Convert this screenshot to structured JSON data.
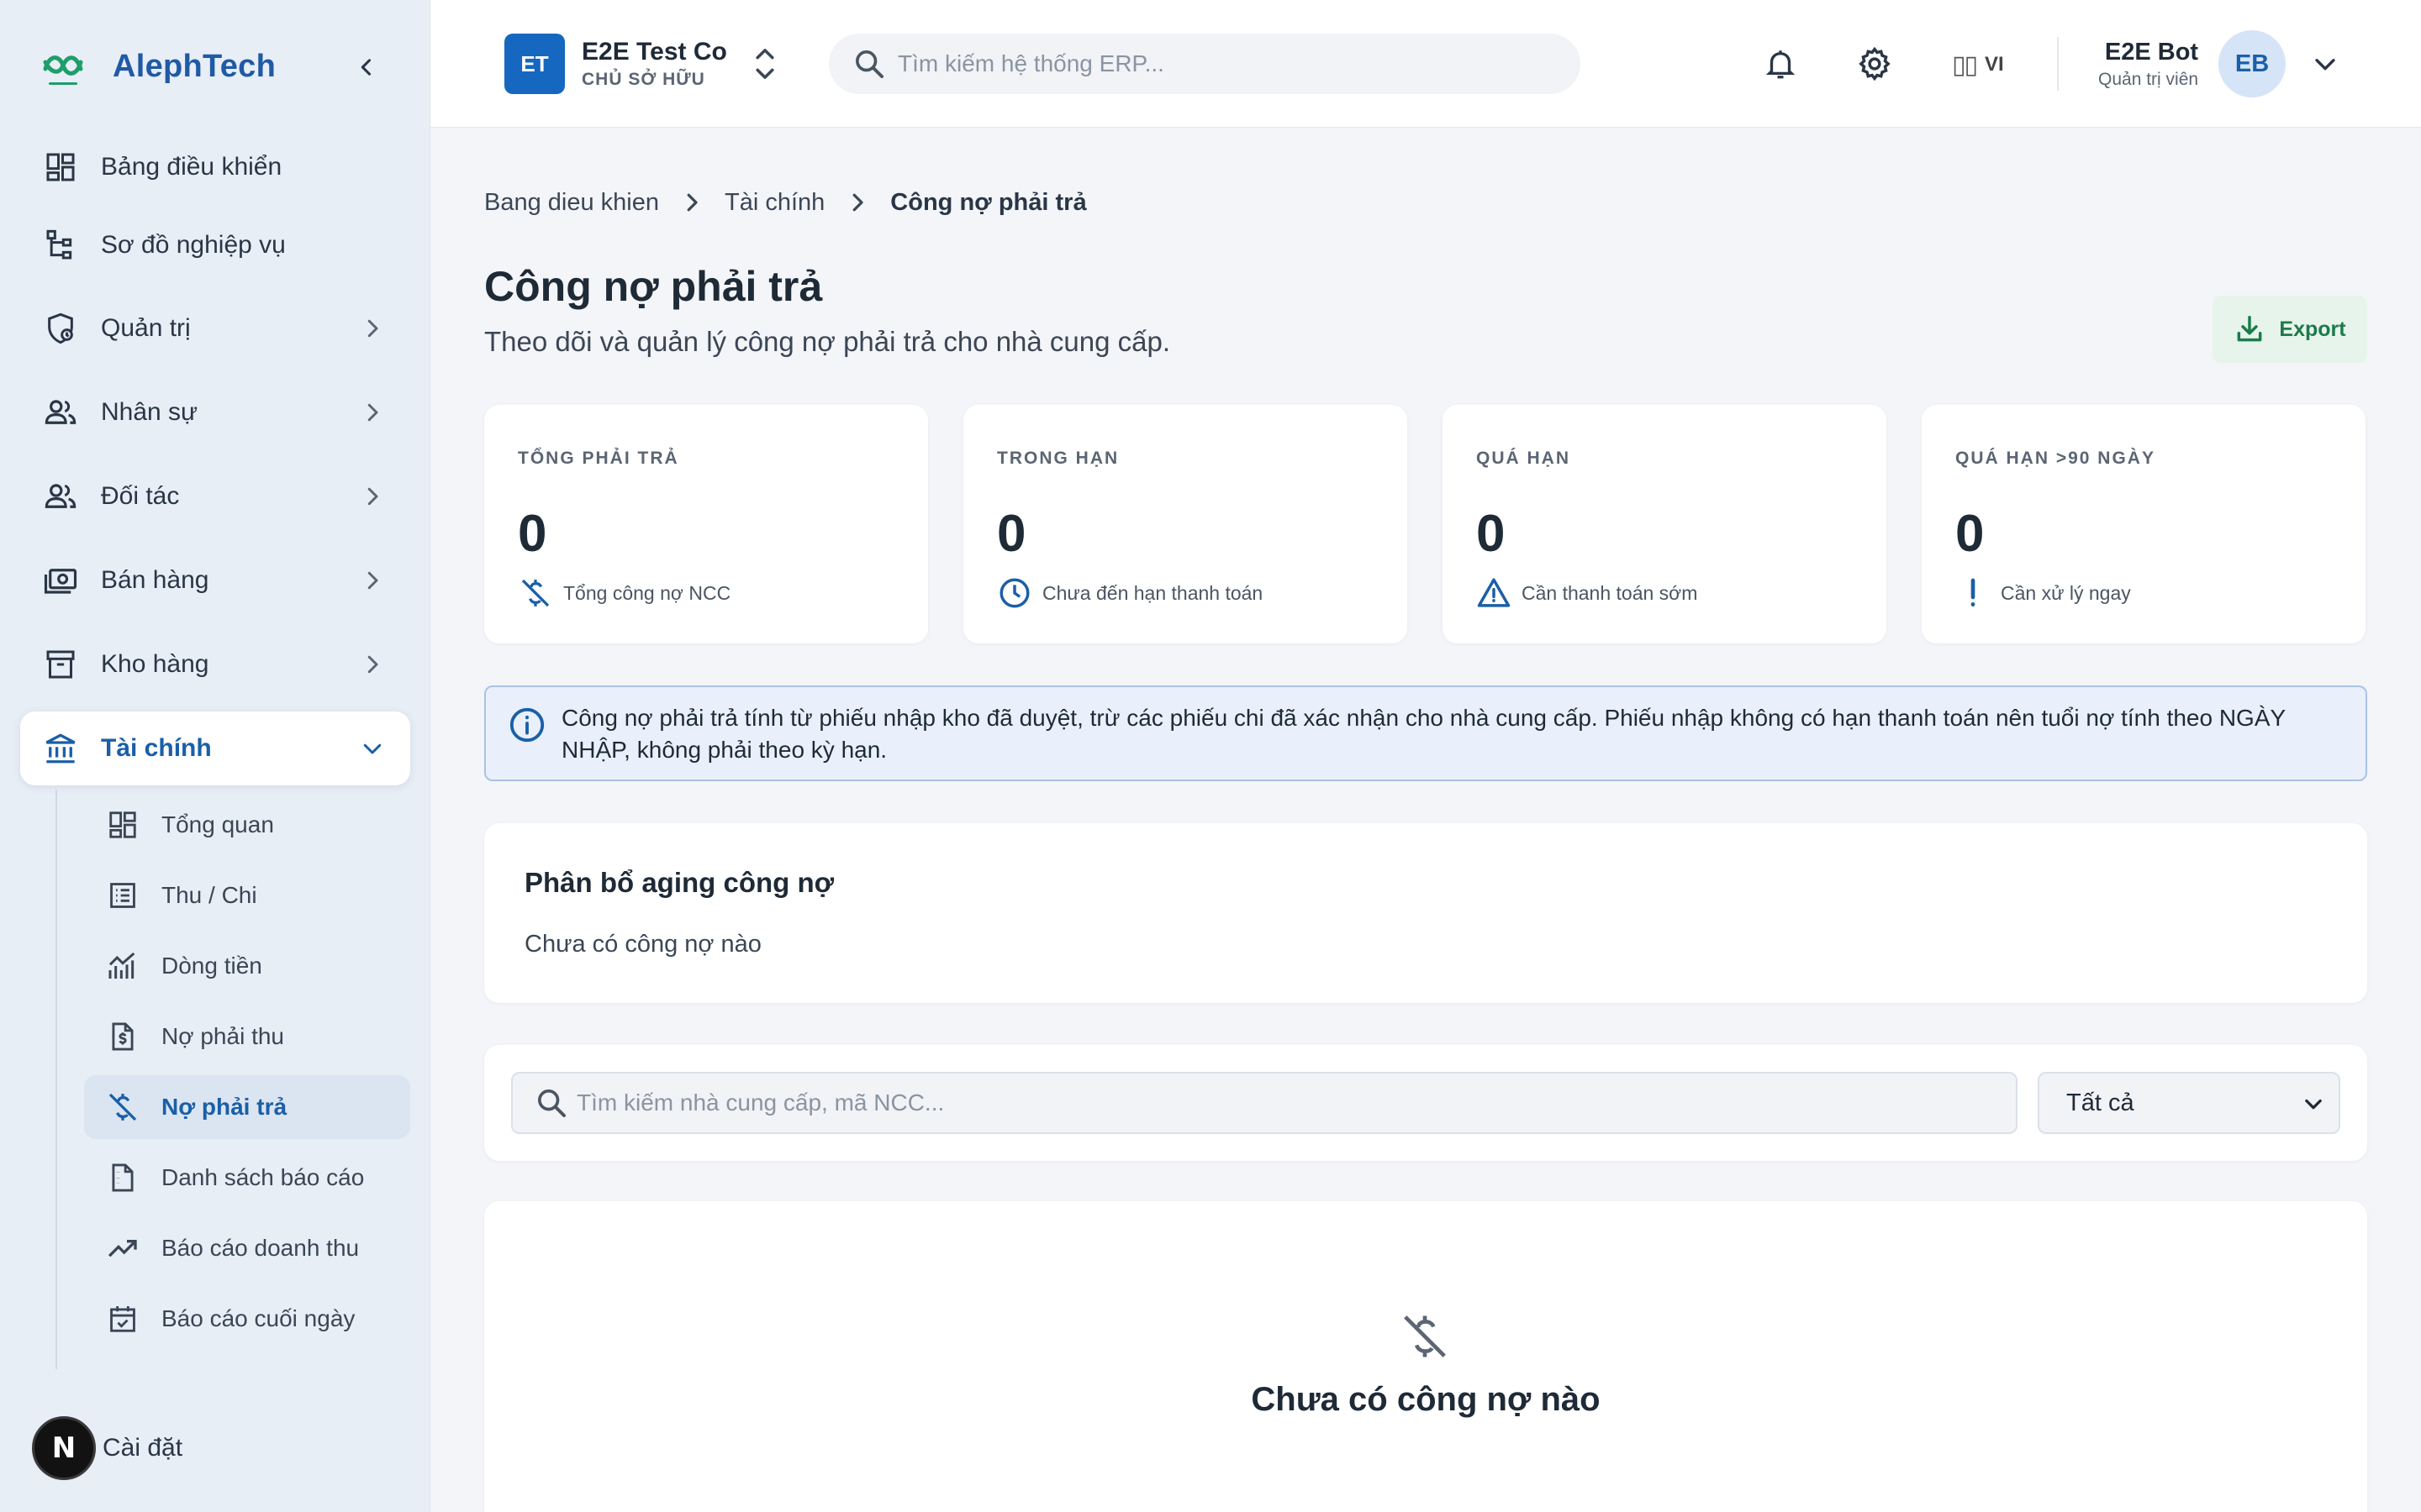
{
  "brand": {
    "name": "AlephTech"
  },
  "sidebar": {
    "items": [
      {
        "label": "Bảng điều khiển",
        "icon": "dashboard-icon"
      },
      {
        "label": "Sơ đồ nghiệp vụ",
        "icon": "sitemap-icon"
      },
      {
        "label": "Quản trị",
        "icon": "admin-shield-icon"
      },
      {
        "label": "Nhân sự",
        "icon": "people-icon"
      },
      {
        "label": "Đối tác",
        "icon": "partners-icon"
      },
      {
        "label": "Bán hàng",
        "icon": "money-icon"
      },
      {
        "label": "Kho hàng",
        "icon": "archive-icon"
      },
      {
        "label": "Tài chính",
        "icon": "bank-icon"
      }
    ],
    "finance_children": [
      {
        "label": "Tổng quan",
        "icon": "dashboard-icon"
      },
      {
        "label": "Thu / Chi",
        "icon": "ledger-icon"
      },
      {
        "label": "Dòng tiền",
        "icon": "chart-line-icon"
      },
      {
        "label": "Nợ phải thu",
        "icon": "invoice-dollar-icon"
      },
      {
        "label": "Nợ phải trả",
        "icon": "money-off-icon"
      },
      {
        "label": "Danh sách báo cáo",
        "icon": "report-icon"
      },
      {
        "label": "Báo cáo doanh thu",
        "icon": "trending-up-icon"
      },
      {
        "label": "Báo cáo cuối ngày",
        "icon": "calendar-check-icon"
      }
    ],
    "footer_label": "Cài đặt",
    "footer_badge": "N"
  },
  "header": {
    "company": {
      "initials": "ET",
      "name": "E2E Test Co",
      "role": "CHỦ SỞ HỮU"
    },
    "search_placeholder": "Tìm kiếm hệ thống ERP...",
    "language": {
      "glyph": "▯▯",
      "code": "VI"
    },
    "user": {
      "name": "E2E Bot",
      "role": "Quản trị viên",
      "initials": "EB"
    }
  },
  "breadcrumb": [
    "Bang dieu khien",
    "Tài chính",
    "Công nợ phải trả"
  ],
  "page": {
    "title": "Công nợ phải trả",
    "subtitle": "Theo dõi và quản lý công nợ phải trả cho nhà cung cấp.",
    "export_label": "Export"
  },
  "stats": [
    {
      "label": "TỔNG PHẢI TRẢ",
      "value": "0",
      "note": "Tổng công nợ NCC",
      "icon": "money-off-icon",
      "icon_color": "#1a5fa8"
    },
    {
      "label": "TRONG HẠN",
      "value": "0",
      "note": "Chưa đến hạn thanh toán",
      "icon": "clock-icon",
      "icon_color": "#1a5fa8"
    },
    {
      "label": "QUÁ HẠN",
      "value": "0",
      "note": "Cần thanh toán sớm",
      "icon": "warning-icon",
      "icon_color": "#1a5fa8"
    },
    {
      "label": "QUÁ HẠN >90 NGÀY",
      "value": "0",
      "note": "Cần xử lý ngay",
      "icon": "exclamation-icon",
      "icon_color": "#1a5fa8"
    }
  ],
  "info": {
    "text": "Công nợ phải trả tính từ phiếu nhập kho đã duyệt, trừ các phiếu chi đã xác nhận cho nhà cung cấp. Phiếu nhập không có hạn thanh toán nên tuổi nợ tính theo NGÀY NHẬP, không phải theo kỳ hạn."
  },
  "aging": {
    "title": "Phân bổ aging công nợ",
    "empty": "Chưa có công nợ nào"
  },
  "filter": {
    "search_placeholder": "Tìm kiếm nhà cung cấp, mã NCC...",
    "status_value": "Tất cả"
  },
  "empty_state": {
    "title": "Chưa có công nợ nào"
  },
  "colors": {
    "accent": "#1a5fa8",
    "brand_green": "#1d9e6a",
    "export_green": "#1d7a4a",
    "sidebar_bg": "#e8eef6"
  }
}
